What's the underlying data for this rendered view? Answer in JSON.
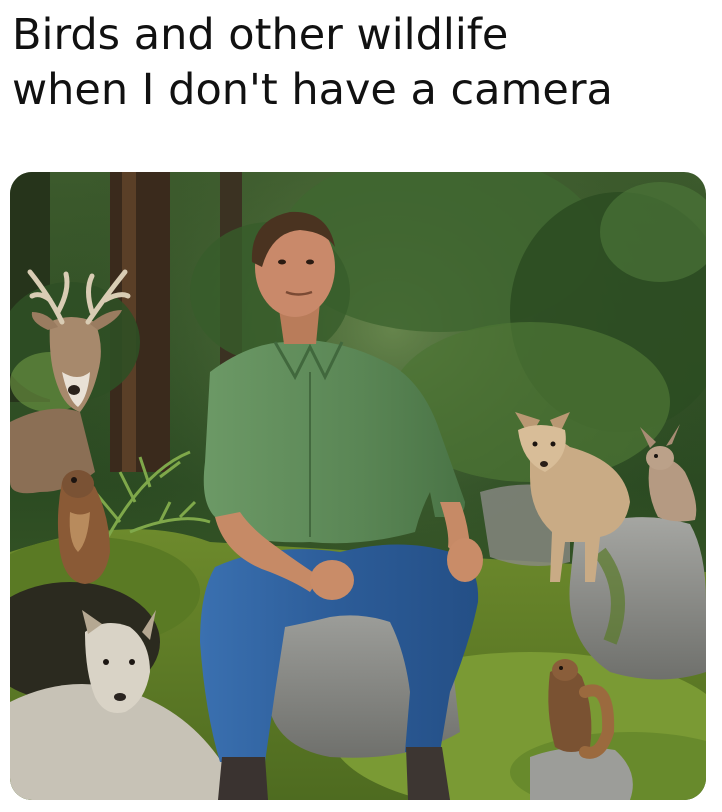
{
  "caption": {
    "line1": "Birds and other wildlife",
    "line2": "when I don't have a camera"
  },
  "colors": {
    "background": "#ffffff",
    "text": "#111111",
    "forest_dark": "#1f3a1c",
    "moss": "#5d7a2a",
    "shirt": "#5e8b5a",
    "jeans": "#2f5f9c",
    "rock": "#8e8f8c"
  }
}
